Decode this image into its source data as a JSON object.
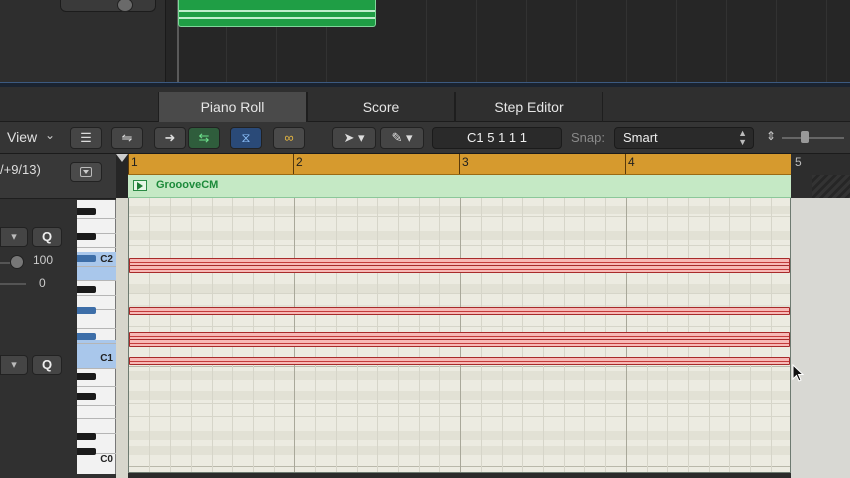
{
  "tabs": [
    {
      "label": "Piano Roll",
      "active": true
    },
    {
      "label": "Score",
      "active": false
    },
    {
      "label": "Step Editor",
      "active": false
    }
  ],
  "toolbar": {
    "view_label": "View",
    "position_text": "C1   5 1 1 1",
    "snap_label": "Snap:",
    "snap_value": "Smart"
  },
  "inspector": {
    "fraction_text": "/+9/13)",
    "q_label": "Q",
    "q_label_2": "Q",
    "value_100": "100",
    "value_0": "0"
  },
  "keyboard": {
    "labels": [
      "C2",
      "C1",
      "C0"
    ]
  },
  "ruler": {
    "bars": [
      "1",
      "2",
      "3",
      "4",
      "5"
    ]
  },
  "region": {
    "name": "GroooveCM",
    "color": "#c5e9c5"
  },
  "colors": {
    "ruler": "#d69a2e",
    "note_fill": "#f7b9b6",
    "note_border": "#a72a2a",
    "top_region": "#1f9e45"
  },
  "notes_count": 6
}
